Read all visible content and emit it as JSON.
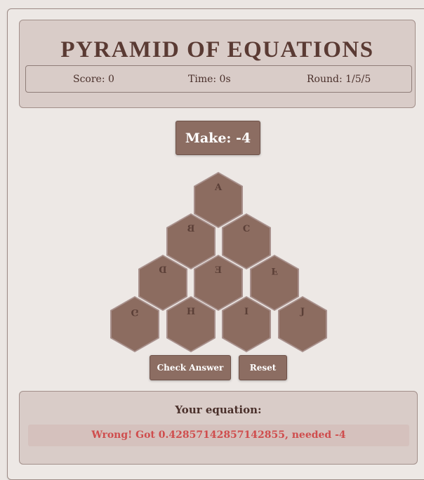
{
  "header": {
    "title": "PYRAMID OF EQUATIONS",
    "score": "Score: 0",
    "time": "Time: 0s",
    "round": "Round: 1/5/5"
  },
  "target": {
    "label": "Make: -4"
  },
  "pyramid": {
    "cells": [
      {
        "id": "A",
        "label": "A"
      },
      {
        "id": "B",
        "label": "B"
      },
      {
        "id": "C",
        "label": "C"
      },
      {
        "id": "D",
        "label": "D"
      },
      {
        "id": "E",
        "label": "E"
      },
      {
        "id": "F",
        "label": "F"
      },
      {
        "id": "G",
        "label": "G"
      },
      {
        "id": "H",
        "label": "H"
      },
      {
        "id": "I",
        "label": "I"
      },
      {
        "id": "J",
        "label": "J"
      }
    ]
  },
  "controls": {
    "check_label": "Check Answer",
    "reset_label": "Reset"
  },
  "equation": {
    "label": "Your equation:",
    "feedback": "Wrong! Got 0.42857142857142855, needed -4"
  },
  "colors": {
    "background": "#ebe6e3",
    "panel": "#d9ccc8",
    "hex_fill": "#8c6c60",
    "button": "#8c6d62",
    "error_text": "#cf4d4d"
  }
}
